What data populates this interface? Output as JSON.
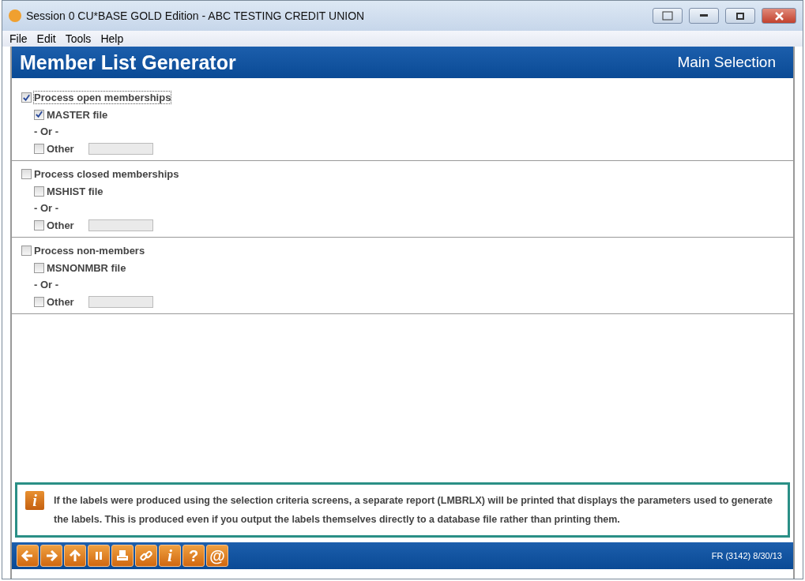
{
  "window": {
    "title": "Session 0 CU*BASE GOLD Edition - ABC TESTING CREDIT UNION"
  },
  "menu": [
    "File",
    "Edit",
    "Tools",
    "Help"
  ],
  "header": {
    "title": "Member List Generator",
    "subtitle": "Main Selection"
  },
  "sections": [
    {
      "label": "Process open memberships",
      "checked": true,
      "file": {
        "label": "MASTER file",
        "checked": true
      },
      "or": "- Or -",
      "other": {
        "label": "Other",
        "checked": false
      }
    },
    {
      "label": "Process closed memberships",
      "checked": false,
      "file": {
        "label": "MSHIST file",
        "checked": false
      },
      "or": "- Or -",
      "other": {
        "label": "Other",
        "checked": false
      }
    },
    {
      "label": "Process non-members",
      "checked": false,
      "file": {
        "label": "MSNONMBR file",
        "checked": false
      },
      "or": "- Or -",
      "other": {
        "label": "Other",
        "checked": false
      }
    }
  ],
  "info": {
    "icon": "i",
    "text": "If the labels were produced using the selection criteria screens, a separate report (LMBRLX) will be printed that displays the parameters used to generate the labels. This is produced even if you output the labels themselves directly to a database file rather than printing them."
  },
  "toolbar": [
    {
      "kind": "back"
    },
    {
      "kind": "forward"
    },
    {
      "kind": "up"
    },
    {
      "kind": "pause"
    },
    {
      "kind": "print"
    },
    {
      "kind": "link"
    },
    {
      "kind": "text",
      "glyph": "i"
    },
    {
      "kind": "text",
      "glyph": "?"
    },
    {
      "kind": "text",
      "glyph": "@"
    }
  ],
  "status": "FR (3142) 8/30/13"
}
